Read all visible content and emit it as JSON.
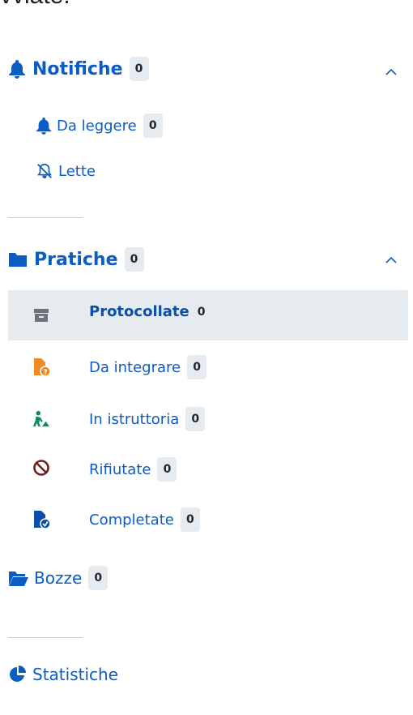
{
  "top_fragment": "vviate.",
  "notifiche": {
    "label": "Notifiche",
    "count": "0",
    "items": [
      {
        "label": "Da leggere",
        "count": "0"
      },
      {
        "label": "Lette"
      }
    ]
  },
  "pratiche": {
    "label": "Pratiche",
    "count": "0",
    "items": [
      {
        "label": "Protocollate",
        "count": "0",
        "active": true,
        "icon": "archive-box-icon"
      },
      {
        "label": "Da integrare",
        "count": "0",
        "icon": "file-question-icon"
      },
      {
        "label": "In istruttoria",
        "count": "0",
        "icon": "person-digging-icon"
      },
      {
        "label": "Rifiutate",
        "count": "0",
        "icon": "ban-icon"
      },
      {
        "label": "Completate",
        "count": "0",
        "icon": "file-check-icon"
      }
    ]
  },
  "bozze": {
    "label": "Bozze",
    "count": "0"
  },
  "statistiche": {
    "label": "Statistiche"
  },
  "colors": {
    "accent": "#0b5cc3",
    "active_bg": "#e6ebf0",
    "orange": "#f08a24",
    "green": "#0f8a66",
    "dark_red": "#6b1f1f"
  }
}
